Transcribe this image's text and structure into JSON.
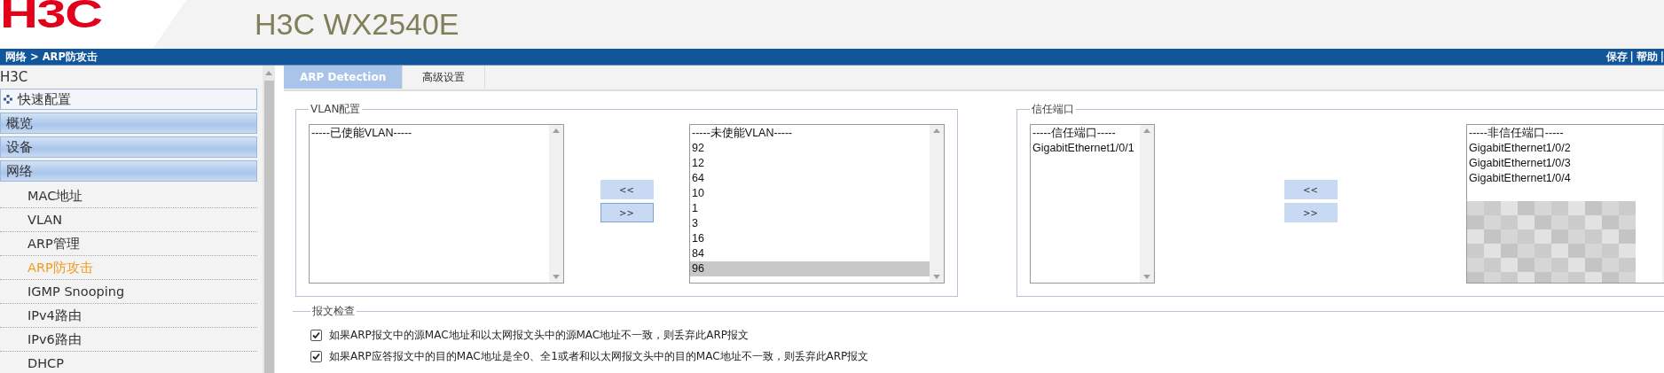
{
  "header": {
    "logo": "H3C",
    "title": "H3C WX2540E"
  },
  "nav_bar": {
    "breadcrumb": "网络 > ARP防攻击",
    "links": [
      "保存",
      "帮助"
    ],
    "separator": "|"
  },
  "sidebar": {
    "root": "H3C",
    "items": [
      {
        "label": "快速配置",
        "kind": "quick"
      },
      {
        "label": "概览",
        "kind": "group"
      },
      {
        "label": "设备",
        "kind": "group"
      },
      {
        "label": "网络",
        "kind": "group",
        "children": [
          {
            "label": "MAC地址",
            "selected": false
          },
          {
            "label": "VLAN",
            "selected": false
          },
          {
            "label": "ARP管理",
            "selected": false
          },
          {
            "label": "ARP防攻击",
            "selected": true
          },
          {
            "label": "IGMP Snooping",
            "selected": false
          },
          {
            "label": "IPv4路由",
            "selected": false
          },
          {
            "label": "IPv6路由",
            "selected": false
          },
          {
            "label": "DHCP",
            "selected": false
          }
        ]
      }
    ]
  },
  "tabs": [
    {
      "label": "ARP Detection",
      "selected": true
    },
    {
      "label": "高级设置",
      "selected": false
    }
  ],
  "vlan_config": {
    "legend": "VLAN配置",
    "enabled_list": {
      "header": "-----已使能VLAN-----"
    },
    "buttons": [
      {
        "label": "<<",
        "focused": false
      },
      {
        "label": ">>",
        "focused": true
      }
    ],
    "disabled_list": {
      "header": "-----未使能VLAN-----",
      "items": [
        {
          "label": "92",
          "selected": false
        },
        {
          "label": "12",
          "selected": false
        },
        {
          "label": "64",
          "selected": false
        },
        {
          "label": "10",
          "selected": false
        },
        {
          "label": "1",
          "selected": false
        },
        {
          "label": "3",
          "selected": false
        },
        {
          "label": "16",
          "selected": false
        },
        {
          "label": "84",
          "selected": false
        },
        {
          "label": "96",
          "selected": true
        }
      ]
    }
  },
  "trusted_ports": {
    "legend": "信任端口",
    "trusted_list": {
      "header": "-----信任端口-----",
      "items": [
        {
          "label": "GigabitEthernet1/0/1",
          "selected": false
        }
      ]
    },
    "buttons": [
      {
        "label": "<<",
        "focused": false
      },
      {
        "label": ">>",
        "focused": false
      }
    ],
    "untrusted_list": {
      "header": "-----非信任端口-----",
      "items": [
        {
          "label": "GigabitEthernet1/0/2",
          "selected": false
        },
        {
          "label": "GigabitEthernet1/0/3",
          "selected": false
        },
        {
          "label": "GigabitEthernet1/0/4",
          "selected": false
        }
      ],
      "redacted": true
    }
  },
  "packet_check": {
    "legend": "报文检查",
    "rules": [
      {
        "label": "如果ARP报文中的源MAC地址和以太网报文头中的源MAC地址不一致，则丢弃此ARP报文",
        "checked": true
      },
      {
        "label": "如果ARP应答报文中的目的MAC地址是全0、全1或者和以太网报文头中的目的MAC地址不一致，则丢弃此ARP报文",
        "checked": true
      }
    ]
  }
}
